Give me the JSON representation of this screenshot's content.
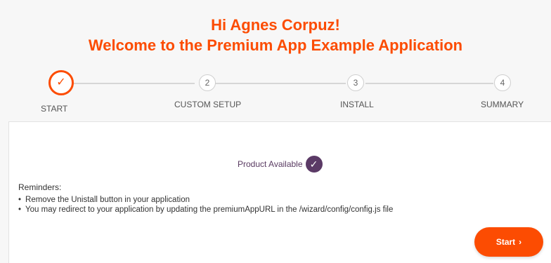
{
  "header": {
    "greeting": "Hi Agnes Corpuz!",
    "welcome": "Welcome to the Premium App Example Application"
  },
  "stepper": {
    "steps": [
      {
        "number": "✓",
        "label": "START"
      },
      {
        "number": "2",
        "label": "CUSTOM SETUP"
      },
      {
        "number": "3",
        "label": "INSTALL"
      },
      {
        "number": "4",
        "label": "SUMMARY"
      }
    ],
    "active_step": 1
  },
  "content": {
    "product_status": "Product Available",
    "check_icon": "✓",
    "reminders_title": "Reminders:",
    "reminders": [
      "Remove the Unistall button in your application",
      "You may redirect to your application by updating the premiumAppURL in the /wizard/config/config.js file"
    ],
    "start_label": "Start",
    "start_icon": "›"
  },
  "colors": {
    "accent": "#fc4c02",
    "badge": "#5b3a66"
  }
}
